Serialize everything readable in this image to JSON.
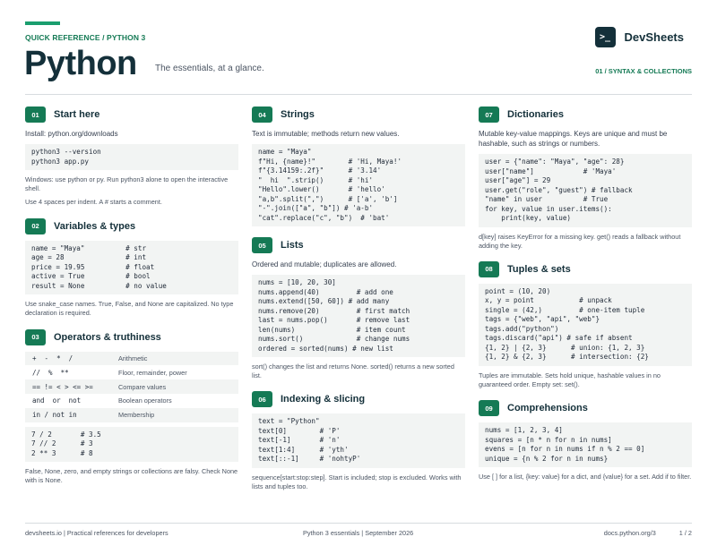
{
  "header": {
    "eyebrow": "QUICK REFERENCE / PYTHON 3",
    "title": "Python",
    "tagline": "The essentials, at a glance.",
    "brand_logo": ">_",
    "brand_name": "DevSheets",
    "section_tag": "01 / SYNTAX & COLLECTIONS"
  },
  "sections": {
    "start": {
      "badge": "01",
      "title": "Start here",
      "install": "Install: python.org/downloads",
      "code": [
        "python3 --version",
        "python3 app.py"
      ],
      "note1": "Windows: use python or py. Run python3 alone to open the interactive shell.",
      "note2": "Use 4 spaces per indent. A # starts a comment."
    },
    "variables": {
      "badge": "02",
      "title": "Variables & types",
      "code": [
        "name = \"Maya\"          # str",
        "age = 28               # int",
        "price = 19.95          # float",
        "active = True          # bool",
        "result = None          # no value"
      ],
      "note": "Use snake_case names. True, False, and None are capitalized. No type declaration is required."
    },
    "operators": {
      "badge": "03",
      "title": "Operators & truthiness",
      "rows": [
        {
          "sym": "+  -  *  /",
          "desc": "Arithmetic"
        },
        {
          "sym": "//  %  **",
          "desc": "Floor, remainder, power"
        },
        {
          "sym": "== != < > <= >=",
          "desc": "Compare values"
        },
        {
          "sym": "and  or  not",
          "desc": "Boolean operators"
        },
        {
          "sym": "in / not in",
          "desc": "Membership"
        }
      ],
      "code": [
        "7 / 2       # 3.5",
        "7 // 2      # 3",
        "2 ** 3      # 8"
      ],
      "note": "False, None, zero, and empty strings or collections are falsy. Check None with is None."
    },
    "strings": {
      "badge": "04",
      "title": "Strings",
      "intro": "Text is immutable; methods return new values.",
      "code": [
        "name = \"Maya\"",
        "f\"Hi, {name}!\"        # 'Hi, Maya!'",
        "f\"{3.14159:.2f}\"      # '3.14'",
        "\"  hi  \".strip()      # 'hi'",
        "\"Hello\".lower()       # 'hello'",
        "\"a,b\".split(\",\")      # ['a', 'b']",
        "\"-\".join([\"a\", \"b\"]) # 'a-b'",
        "\"cat\".replace(\"c\", \"b\")  # 'bat'"
      ]
    },
    "lists": {
      "badge": "05",
      "title": "Lists",
      "intro": "Ordered and mutable; duplicates are allowed.",
      "code": [
        "nums = [10, 20, 30]",
        "nums.append(40)         # add one",
        "nums.extend([50, 60]) # add many",
        "nums.remove(20)         # first match",
        "last = nums.pop()       # remove last",
        "len(nums)               # item count",
        "nums.sort()             # change nums",
        "ordered = sorted(nums) # new list"
      ],
      "note": "sort() changes the list and returns None. sorted() returns a new sorted list."
    },
    "indexing": {
      "badge": "06",
      "title": "Indexing & slicing",
      "code": [
        "text = \"Python\"",
        "text[0]        # 'P'",
        "text[-1]       # 'n'",
        "text[1:4]      # 'yth'",
        "text[::-1]     # 'nohtyP'"
      ],
      "note": "sequence[start:stop:step]. Start is included; stop is excluded. Works with lists and tuples too."
    },
    "dicts": {
      "badge": "07",
      "title": "Dictionaries",
      "intro": "Mutable key-value mappings. Keys are unique and must be hashable, such as strings or numbers.",
      "code": [
        "user = {\"name\": \"Maya\", \"age\": 28}",
        "user[\"name\"]            # 'Maya'",
        "user[\"age\"] = 29",
        "user.get(\"role\", \"guest\") # fallback",
        "\"name\" in user          # True",
        "for key, value in user.items():",
        "    print(key, value)"
      ],
      "note": "d[key] raises KeyError for a missing key. get() reads a fallback without adding the key."
    },
    "tuples": {
      "badge": "08",
      "title": "Tuples & sets",
      "code": [
        "point = (10, 20)",
        "x, y = point           # unpack",
        "single = (42,)         # one-item tuple",
        "tags = {\"web\", \"api\", \"web\"}",
        "tags.add(\"python\")",
        "tags.discard(\"api\") # safe if absent",
        "{1, 2} | {2, 3}      # union: {1, 2, 3}",
        "{1, 2} & {2, 3}      # intersection: {2}"
      ],
      "note": "Tuples are immutable. Sets hold unique, hashable values in no guaranteed order. Empty set: set()."
    },
    "comprehensions": {
      "badge": "09",
      "title": "Comprehensions",
      "code": [
        "nums = [1, 2, 3, 4]",
        "squares = [n * n for n in nums]",
        "evens = [n for n in nums if n % 2 == 0]",
        "unique = {n % 2 for n in nums}"
      ],
      "note": "Use [ ] for a list, {key: value} for a dict, and {value} for a set. Add if to filter."
    }
  },
  "footer": {
    "left": "devsheets.io  |  Practical references for developers",
    "center": "Python 3 essentials  |  September 2026",
    "url": "docs.python.org/3",
    "page": "1 / 2"
  },
  "colors": {
    "accent": "#157a55",
    "ink": "#14303a",
    "code_bg": "#f2f4f3"
  }
}
